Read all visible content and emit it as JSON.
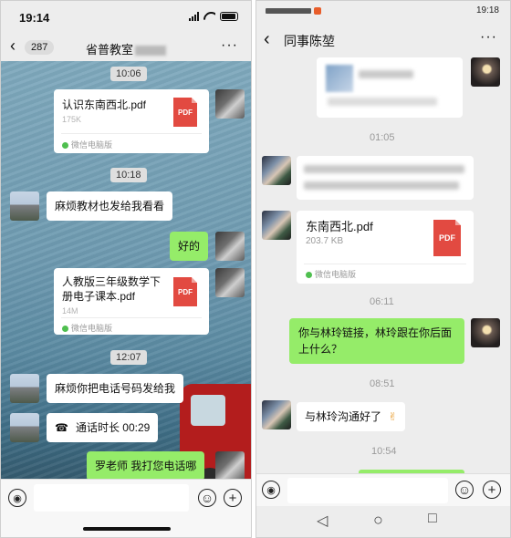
{
  "left": {
    "status": {
      "time": "19:14"
    },
    "nav": {
      "back_count": "287",
      "title": "省普教室"
    },
    "messages": {
      "t1": "10:06",
      "file1": {
        "name": "认识东南西北.pdf",
        "size": "175K",
        "source": "微信电脑版",
        "type": "PDF"
      },
      "t2": "10:18",
      "m1": "麻烦教材也发给我看看",
      "m2": "好的",
      "file2": {
        "name_l1": "人教版三年级数学下",
        "name_l2": "册电子课本.pdf",
        "size": "14M",
        "source": "微信电脑版",
        "type": "PDF"
      },
      "t3": "12:07",
      "m3": "麻烦你把电话号码发给我",
      "call": "通话时长 00:29",
      "m4": "罗老师 我打您电话哪"
    }
  },
  "right": {
    "status": {
      "time": "19:18"
    },
    "nav": {
      "title": "同事陈堃"
    },
    "messages": {
      "t1": "01:05",
      "file": {
        "name": "东南西北.pdf",
        "size": "203.7 KB",
        "source": "微信电脑版",
        "type": "PDF"
      },
      "t2": "06:11",
      "m1": "你与林玲链接，林玲跟在你后面上什么？",
      "t3": "08:51",
      "m2": "与林玲沟通好了",
      "m2_emoji": "✌",
      "t4": "10:54"
    }
  },
  "icons": {
    "back": "‹",
    "more": "···",
    "voice": "◉",
    "emoji": "☺",
    "plus": "+",
    "call": "☎",
    "nav_back": "◁",
    "nav_home": "○",
    "nav_recent": "□"
  }
}
